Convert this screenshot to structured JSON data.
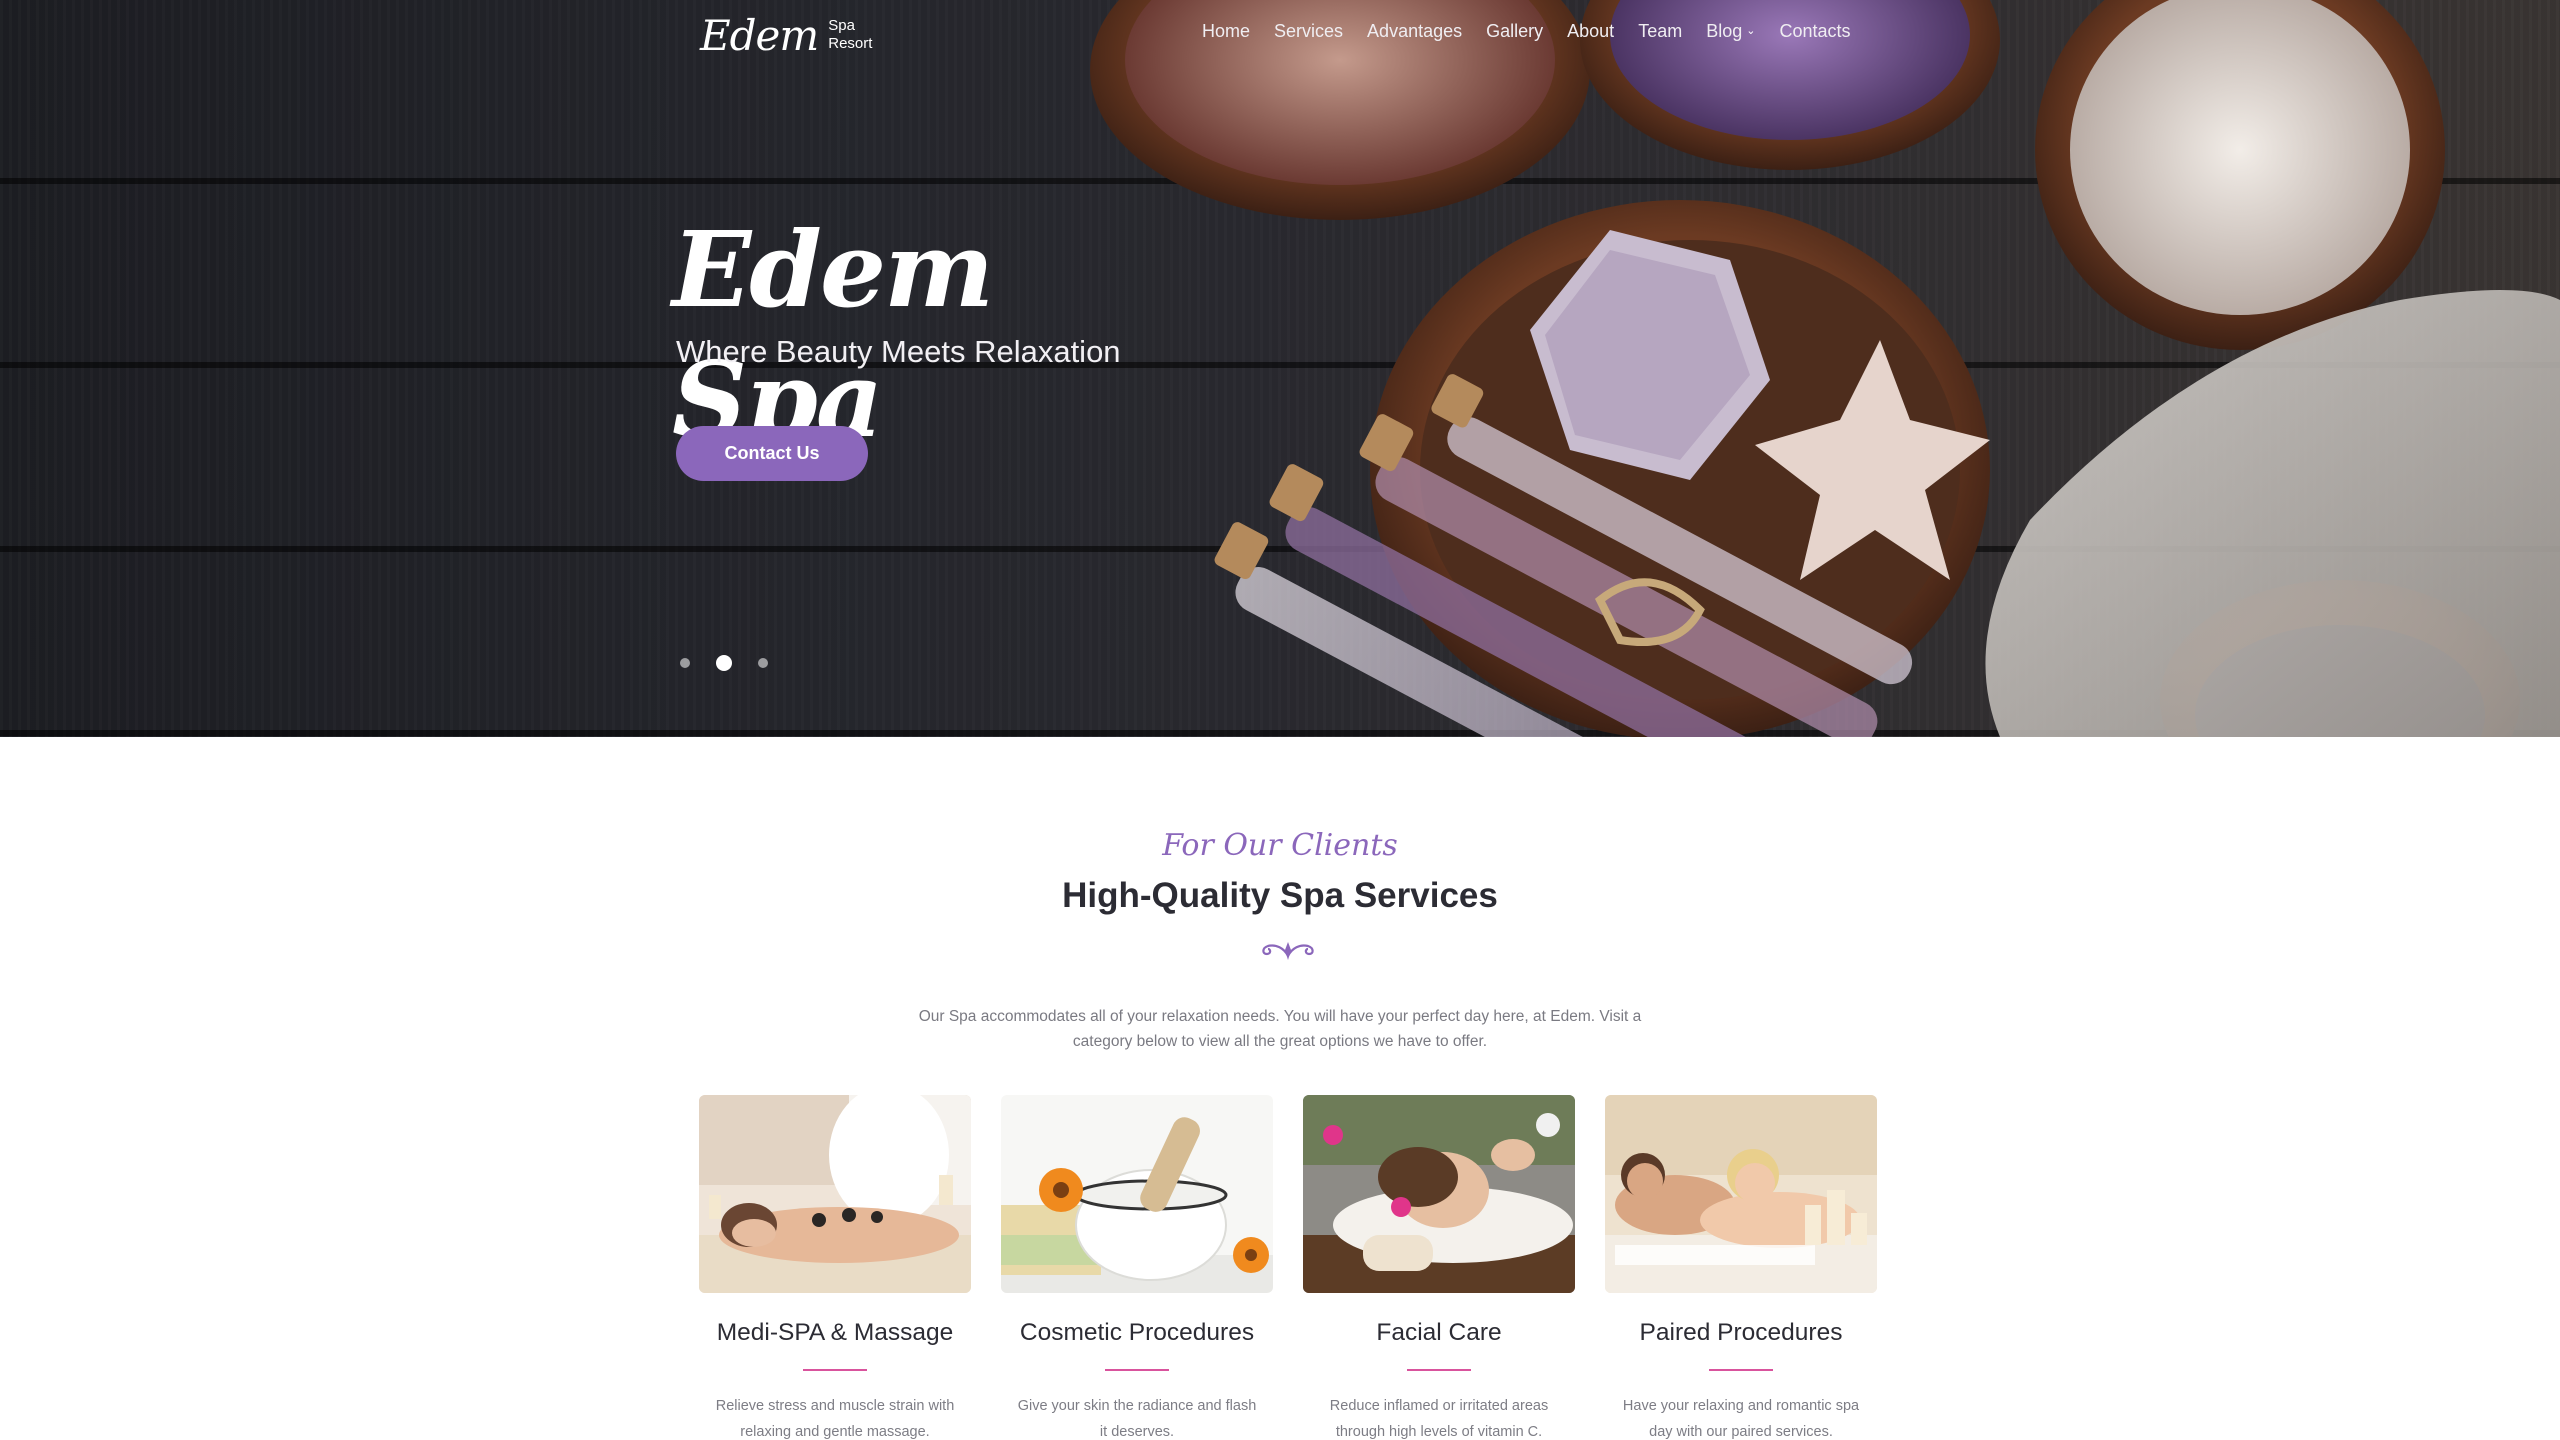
{
  "brand": {
    "name": "Edem",
    "sub_line1": "Spa",
    "sub_line2": "Resort"
  },
  "nav": {
    "items": [
      "Home",
      "Services",
      "Advantages",
      "Gallery",
      "About",
      "Team",
      "Blog",
      "Contacts"
    ],
    "blog_has_dropdown": true
  },
  "hero": {
    "title": "Edem Spa",
    "tagline": "Where Beauty Meets Relaxation",
    "cta_label": "Contact Us",
    "slide_count": 3,
    "active_slide": 2
  },
  "services": {
    "eyebrow": "For Our Clients",
    "title": "High-Quality Spa Services",
    "intro": "Our Spa accommodates all of your relaxation needs. You will have your perfect day here, at Edem. Visit a category below to view all the great options we have to offer.",
    "cards": [
      {
        "title": "Medi-SPA & Massage",
        "text": "Relieve stress and muscle strain with relaxing and gentle massage."
      },
      {
        "title": "Cosmetic Procedures",
        "text": "Give your skin the radiance and flash it deserves."
      },
      {
        "title": "Facial Care",
        "text": "Reduce inflamed or irritated areas through high levels of vitamin C."
      },
      {
        "title": "Paired Procedures",
        "text": "Have your relaxing and romantic spa day with our paired services."
      }
    ]
  },
  "colors": {
    "accent_purple": "#8b67bb",
    "accent_pink": "#d9539d",
    "hero_bg": "#25262b"
  }
}
